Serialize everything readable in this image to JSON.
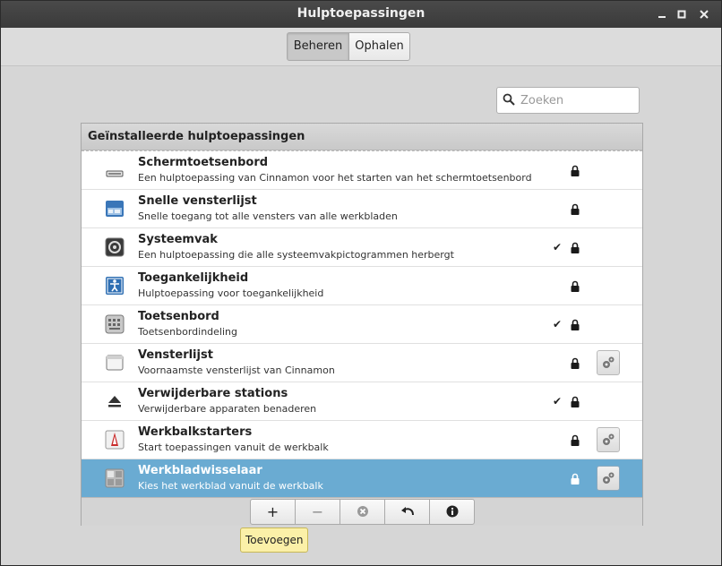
{
  "window": {
    "title": "Hulptoepassingen"
  },
  "tabs": [
    {
      "label": "Beheren",
      "active": true
    },
    {
      "label": "Ophalen",
      "active": false
    }
  ],
  "search": {
    "placeholder": "Zoeken",
    "value": ""
  },
  "list": {
    "header": "Geïnstalleerde hulptoepassingen",
    "items": [
      {
        "name": "Schermtoetsenbord",
        "description": "Een hulptoepassing van Cinnamon voor het starten van het schermtoetsenbord",
        "icon": "keyboard-small-icon",
        "enabled": false,
        "locked": true,
        "configurable": false
      },
      {
        "name": "Snelle vensterlijst",
        "description": "Snelle toegang tot alle vensters van alle werkbladen",
        "icon": "window-list-icon",
        "enabled": false,
        "locked": true,
        "configurable": false
      },
      {
        "name": "Systeemvak",
        "description": "Een hulptoepassing die alle systeemvakpictogrammen herbergt",
        "icon": "system-tray-icon",
        "enabled": true,
        "locked": true,
        "configurable": false
      },
      {
        "name": "Toegankelijkheid",
        "description": "Hulptoepassing voor toegankelijkheid",
        "icon": "accessibility-icon",
        "enabled": false,
        "locked": true,
        "configurable": false
      },
      {
        "name": "Toetsenbord",
        "description": "Toetsenbordindeling",
        "icon": "keyboard-icon",
        "enabled": true,
        "locked": true,
        "configurable": false
      },
      {
        "name": "Vensterlijst",
        "description": "Voornaamste vensterlijst van Cinnamon",
        "icon": "window-icon",
        "enabled": false,
        "locked": true,
        "configurable": true
      },
      {
        "name": "Verwijderbare stations",
        "description": "Verwijderbare apparaten benaderen",
        "icon": "eject-icon",
        "enabled": true,
        "locked": true,
        "configurable": false
      },
      {
        "name": "Werkbalkstarters",
        "description": "Start toepassingen vanuit de werkbalk",
        "icon": "launcher-icon",
        "enabled": false,
        "locked": true,
        "configurable": true
      },
      {
        "name": "Werkbladwisselaar",
        "description": "Kies het werkblad vanuit de werkbalk",
        "icon": "workspace-switcher-icon",
        "enabled": false,
        "locked": true,
        "configurable": true,
        "selected": true
      }
    ]
  },
  "actions": {
    "add": "+",
    "remove": "−",
    "uninstall": "cancel-icon",
    "restore": "undo-icon",
    "info": "info-icon"
  },
  "tooltip": "Toevoegen",
  "colors": {
    "selection": "#6aabd2",
    "titlebar": "#3f3f3f",
    "tooltip": "#fbf0a8"
  }
}
